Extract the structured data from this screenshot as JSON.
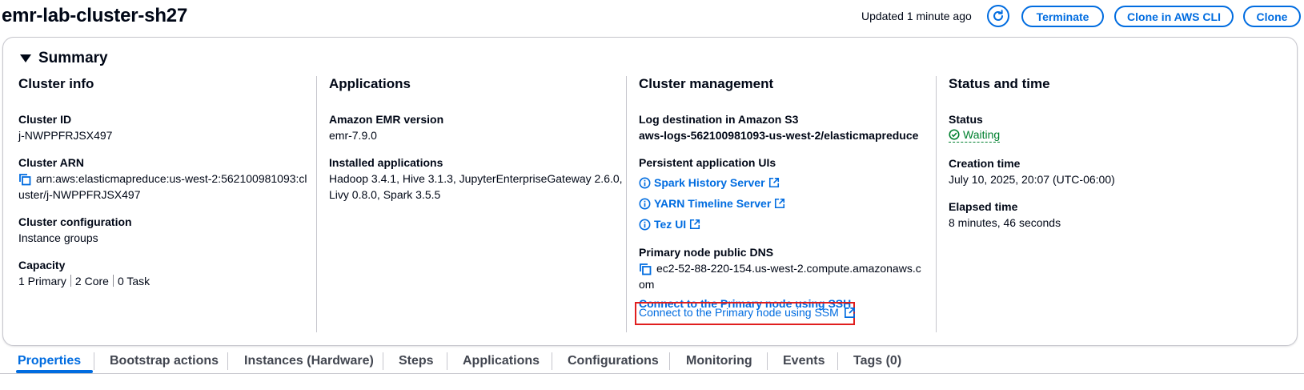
{
  "header": {
    "title": "emr-lab-cluster-sh27",
    "updated": "Updated 1 minute ago",
    "buttons": {
      "terminate": "Terminate",
      "clone_cli": "Clone in AWS CLI",
      "clone": "Clone"
    }
  },
  "summary": {
    "title": "Summary",
    "cluster_info": {
      "heading": "Cluster info",
      "cluster_id_label": "Cluster ID",
      "cluster_id": "j-NWPPFRJSX497",
      "cluster_arn_label": "Cluster ARN",
      "cluster_arn_line1": "arn:aws:elasticmapreduce:us-west-2:562100981093:cl",
      "cluster_arn_line2": "uster/j-NWPPFRJSX497",
      "config_label": "Cluster configuration",
      "config_value": "Instance groups",
      "capacity_label": "Capacity",
      "capacity": [
        "1 Primary",
        "2 Core",
        "0 Task"
      ]
    },
    "applications": {
      "heading": "Applications",
      "emr_version_label": "Amazon EMR version",
      "emr_version": "emr-7.9.0",
      "installed_label": "Installed applications",
      "installed_line1": "Hadoop 3.4.1, Hive 3.1.3, JupyterEnterpriseGateway 2.6.0,",
      "installed_line2": "Livy 0.8.0, Spark 3.5.5"
    },
    "cluster_management": {
      "heading": "Cluster management",
      "log_label": "Log destination in Amazon S3",
      "log_value": "aws-logs-562100981093-us-west-2/elasticmapreduce",
      "persistent_label": "Persistent application UIs",
      "ui_links": [
        "Spark History Server",
        "YARN Timeline Server",
        "Tez UI"
      ],
      "dns_label": "Primary node public DNS",
      "dns_line1": "ec2-52-88-220-154.us-west-2.compute.amazonaws.c",
      "dns_line2": "om",
      "ssh_link": "Connect to the Primary node using SSH",
      "ssm_link": "Connect to the Primary node using SSM"
    },
    "status_time": {
      "heading": "Status and time",
      "status_label": "Status",
      "status_value": "Waiting",
      "creation_label": "Creation time",
      "creation_value": "July 10, 2025, 20:07 (UTC-06:00)",
      "elapsed_label": "Elapsed time",
      "elapsed_value": "8 minutes, 46 seconds"
    }
  },
  "tabs": [
    "Properties",
    "Bootstrap actions",
    "Instances (Hardware)",
    "Steps",
    "Applications",
    "Configurations",
    "Monitoring",
    "Events",
    "Tags (0)"
  ],
  "colors": {
    "accent": "#006ce0",
    "success": "#00802f",
    "highlight": "#e01e1e"
  }
}
